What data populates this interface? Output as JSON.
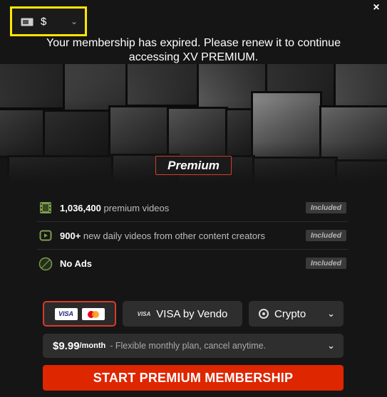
{
  "currency": {
    "symbol": "$",
    "icon": "cash-icon"
  },
  "close": {
    "label": "×"
  },
  "message": "Your membership has expired. Please renew it to continue accessing XV PREMIUM.",
  "badge": "Premium",
  "features": [
    {
      "strong": "1,036,400",
      "text": " premium videos",
      "badge": "Included",
      "icon": "film-icon"
    },
    {
      "strong": "900+",
      "text": " new daily videos from other content creators",
      "badge": "Included",
      "icon": "play-icon"
    },
    {
      "strong": "No Ads",
      "text": "",
      "badge": "Included",
      "icon": "no-ads-icon"
    }
  ],
  "payment": {
    "cards": {
      "visa": "VISA"
    },
    "vendo": {
      "mark": "VISA",
      "label": "VISA by Vendo"
    },
    "crypto": {
      "label": "Crypto"
    }
  },
  "plan": {
    "price": "$9.99",
    "period": "/month",
    "description": "- Flexible monthly plan, cancel anytime."
  },
  "cta": "START PREMIUM MEMBERSHIP",
  "colors": {
    "accent": "#de2600",
    "highlight": "#ffe600",
    "badge_border": "#d63b2b"
  }
}
